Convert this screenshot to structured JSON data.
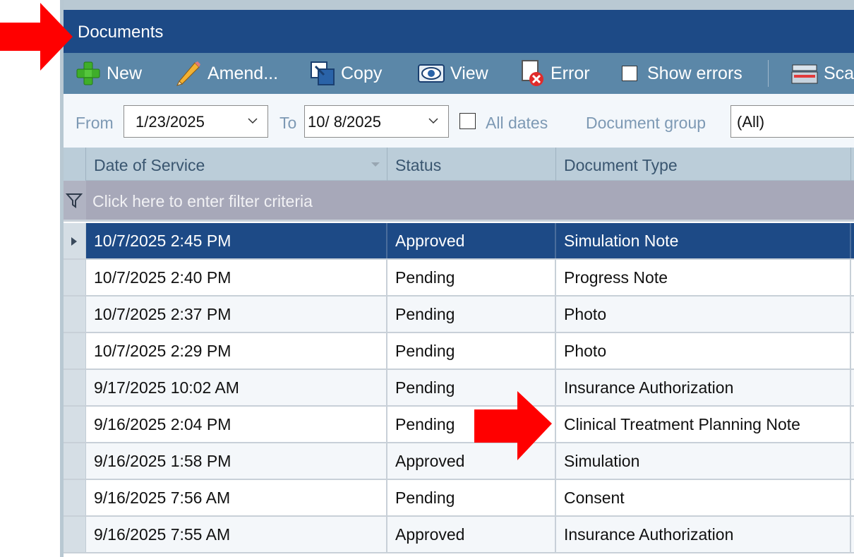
{
  "panel": {
    "title": "Documents"
  },
  "toolbar": {
    "new_label": "New",
    "amend_label": "Amend...",
    "copy_label": "Copy",
    "view_label": "View",
    "error_label": "Error",
    "show_errors_label": "Show errors",
    "scan_label": "Scan"
  },
  "filters": {
    "from_label": "From",
    "from_value": "1/23/2025",
    "to_label": "To",
    "to_value": "10/  8/2025",
    "all_dates_label": "All dates",
    "document_group_label": "Document group",
    "document_group_value": "(All)"
  },
  "grid": {
    "columns": [
      "Date of Service",
      "Status",
      "Document Type"
    ],
    "filter_placeholder": "Click here to enter filter criteria",
    "rows": [
      {
        "date": "10/7/2025 2:45 PM",
        "status": "Approved",
        "type": "Simulation Note"
      },
      {
        "date": "10/7/2025 2:40 PM",
        "status": "Pending",
        "type": "Progress Note"
      },
      {
        "date": "10/7/2025 2:37 PM",
        "status": "Pending",
        "type": "Photo"
      },
      {
        "date": "10/7/2025 2:29 PM",
        "status": "Pending",
        "type": "Photo"
      },
      {
        "date": "9/17/2025 10:02 AM",
        "status": "Pending",
        "type": "Insurance Authorization"
      },
      {
        "date": "9/16/2025 2:04 PM",
        "status": "Pending",
        "type": "Clinical Treatment Planning Note"
      },
      {
        "date": "9/16/2025 1:58 PM",
        "status": "Approved",
        "type": "Simulation"
      },
      {
        "date": "9/16/2025 7:56 AM",
        "status": "Pending",
        "type": "Consent"
      },
      {
        "date": "9/16/2025 7:55 AM",
        "status": "Approved",
        "type": "Insurance Authorization"
      }
    ]
  },
  "colors": {
    "title_bar": "#1d4a86",
    "toolbar": "#5b87a8",
    "selected_row": "#1d4a86",
    "annotation_arrow": "#ff0000"
  }
}
